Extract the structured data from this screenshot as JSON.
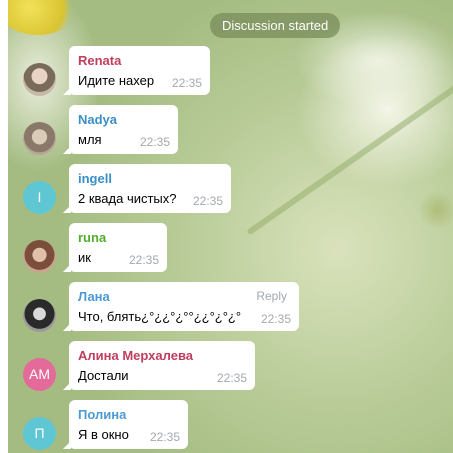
{
  "service_message": "Discussion started",
  "colors": {
    "renata": "#c03d5e",
    "nadya": "#3a8fc6",
    "ingell": "#3a8fc6",
    "runa": "#4fad2d",
    "lana": "#4a9ad6",
    "alina": "#c03d5e",
    "polina": "#4a9ad6",
    "avatar_teal": "#5fc6d3",
    "avatar_pink": "#e46a9a"
  },
  "messages": [
    {
      "sender": "Renata",
      "text": "Идите нахер",
      "time": "22:35",
      "avatar": "photo"
    },
    {
      "sender": "Nadya",
      "text": "мля",
      "time": "22:35",
      "avatar": "photo"
    },
    {
      "sender": "ingell",
      "text": "2 квада чистых?",
      "time": "22:35",
      "avatar_initials": "I"
    },
    {
      "sender": "runa",
      "text": "ик",
      "time": "22:35",
      "avatar": "photo"
    },
    {
      "sender": "Лана",
      "text": "Что, блять¿°¿¿°¿°°¿¿°¿°¿°",
      "time": "22:35",
      "reply_label": "Reply",
      "avatar": "photo"
    },
    {
      "sender": "Алина Мерхалева",
      "text": "Достали",
      "time": "22:35",
      "avatar_initials": "АМ"
    },
    {
      "sender": "Полина",
      "text": "Я в окно",
      "time": "22:35",
      "avatar_initials": "П"
    }
  ]
}
